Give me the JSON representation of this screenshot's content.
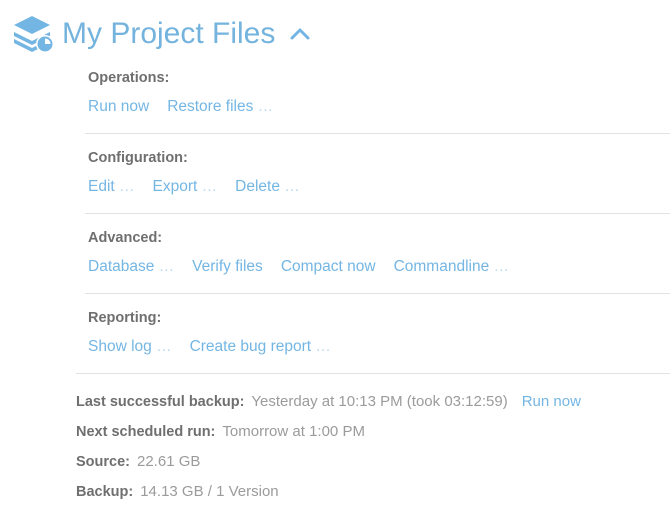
{
  "header": {
    "title": "My Project Files",
    "icon": "layers-clock-icon",
    "collapse_icon": "chevron-up-icon",
    "accent_color": "#73b3dd"
  },
  "sections": [
    {
      "label": "Operations:",
      "has_divider": false,
      "links": [
        {
          "text": "Run now",
          "ellipsis": ""
        },
        {
          "text": "Restore files",
          "ellipsis": " …"
        }
      ]
    },
    {
      "label": "Configuration:",
      "has_divider": true,
      "links": [
        {
          "text": "Edit",
          "ellipsis": " …"
        },
        {
          "text": "Export",
          "ellipsis": " …"
        },
        {
          "text": "Delete",
          "ellipsis": " …"
        }
      ]
    },
    {
      "label": "Advanced:",
      "has_divider": true,
      "links": [
        {
          "text": "Database",
          "ellipsis": " …"
        },
        {
          "text": "Verify files",
          "ellipsis": ""
        },
        {
          "text": "Compact now",
          "ellipsis": ""
        },
        {
          "text": "Commandline",
          "ellipsis": " …"
        }
      ]
    },
    {
      "label": "Reporting:",
      "has_divider": true,
      "links": [
        {
          "text": "Show log",
          "ellipsis": " …"
        },
        {
          "text": "Create bug report",
          "ellipsis": " …"
        }
      ]
    }
  ],
  "status": {
    "rows": [
      {
        "label": "Last successful backup:",
        "value": "Yesterday at 10:13 PM (took 03:12:59)",
        "action": "Run now"
      },
      {
        "label": "Next scheduled run:",
        "value": "Tomorrow at 1:00 PM",
        "action": ""
      },
      {
        "label": "Source:",
        "value": "22.61 GB",
        "action": ""
      },
      {
        "label": "Backup:",
        "value": "14.13 GB / 1 Version",
        "action": ""
      }
    ]
  },
  "colors": {
    "link": "#74b6e3",
    "label": "#6f6f6f",
    "value": "#9b9b9b",
    "divider": "#e2e2e2"
  }
}
